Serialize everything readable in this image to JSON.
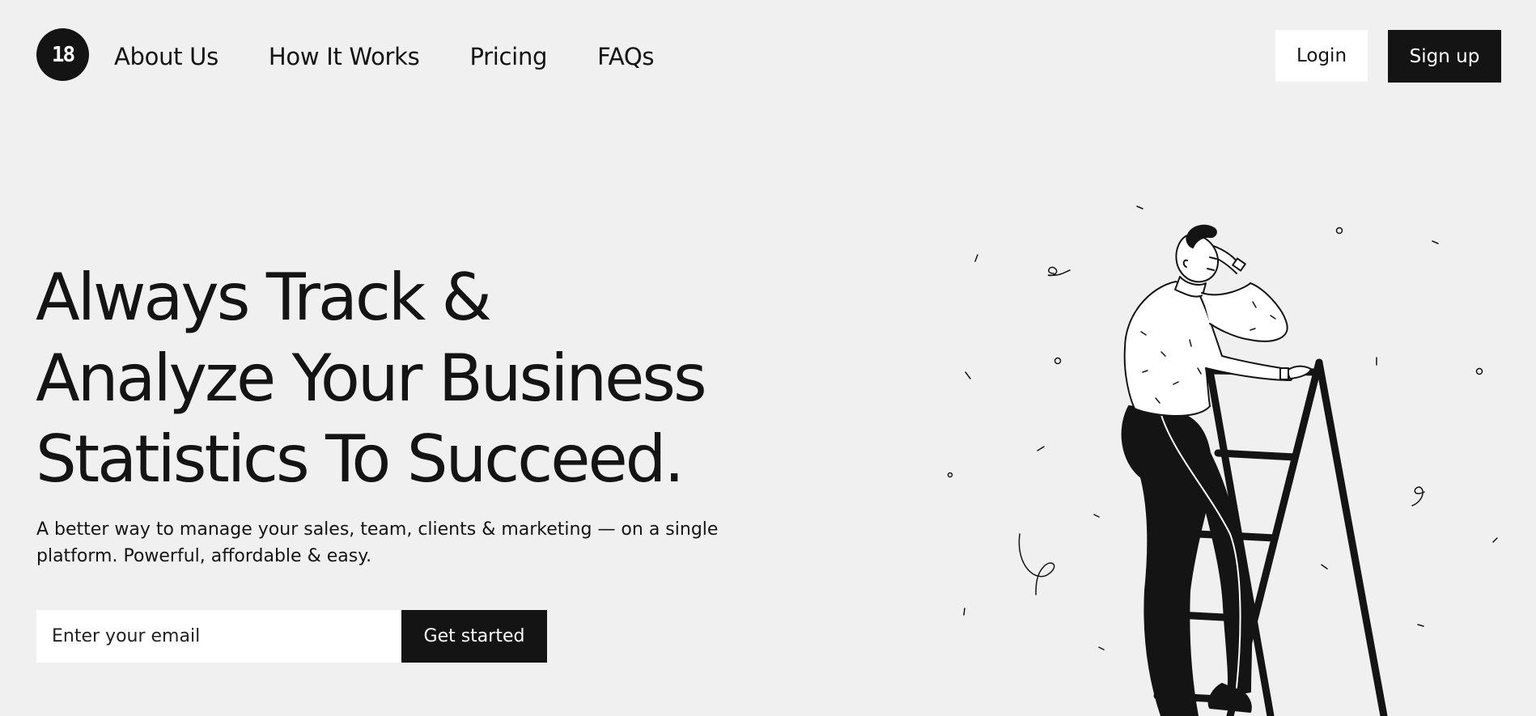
{
  "brand": {
    "logo_text": "18"
  },
  "nav": {
    "items": [
      {
        "label": "About Us"
      },
      {
        "label": "How It Works"
      },
      {
        "label": "Pricing"
      },
      {
        "label": "FAQs"
      }
    ],
    "login_label": "Login",
    "signup_label": "Sign up"
  },
  "hero": {
    "headline_lines": [
      "Always Track &",
      "Analyze Your Business",
      "Statistics To Succeed."
    ],
    "subtext": "A better way to manage your sales, team, clients & marketing — on a single platform. Powerful, affordable & easy.",
    "email_placeholder": "Enter your email",
    "cta_label": "Get started"
  },
  "illustration": {
    "icon": "man-on-ladder-illustration"
  },
  "colors": {
    "background": "#f0f0f0",
    "ink": "#141414",
    "white": "#ffffff"
  }
}
